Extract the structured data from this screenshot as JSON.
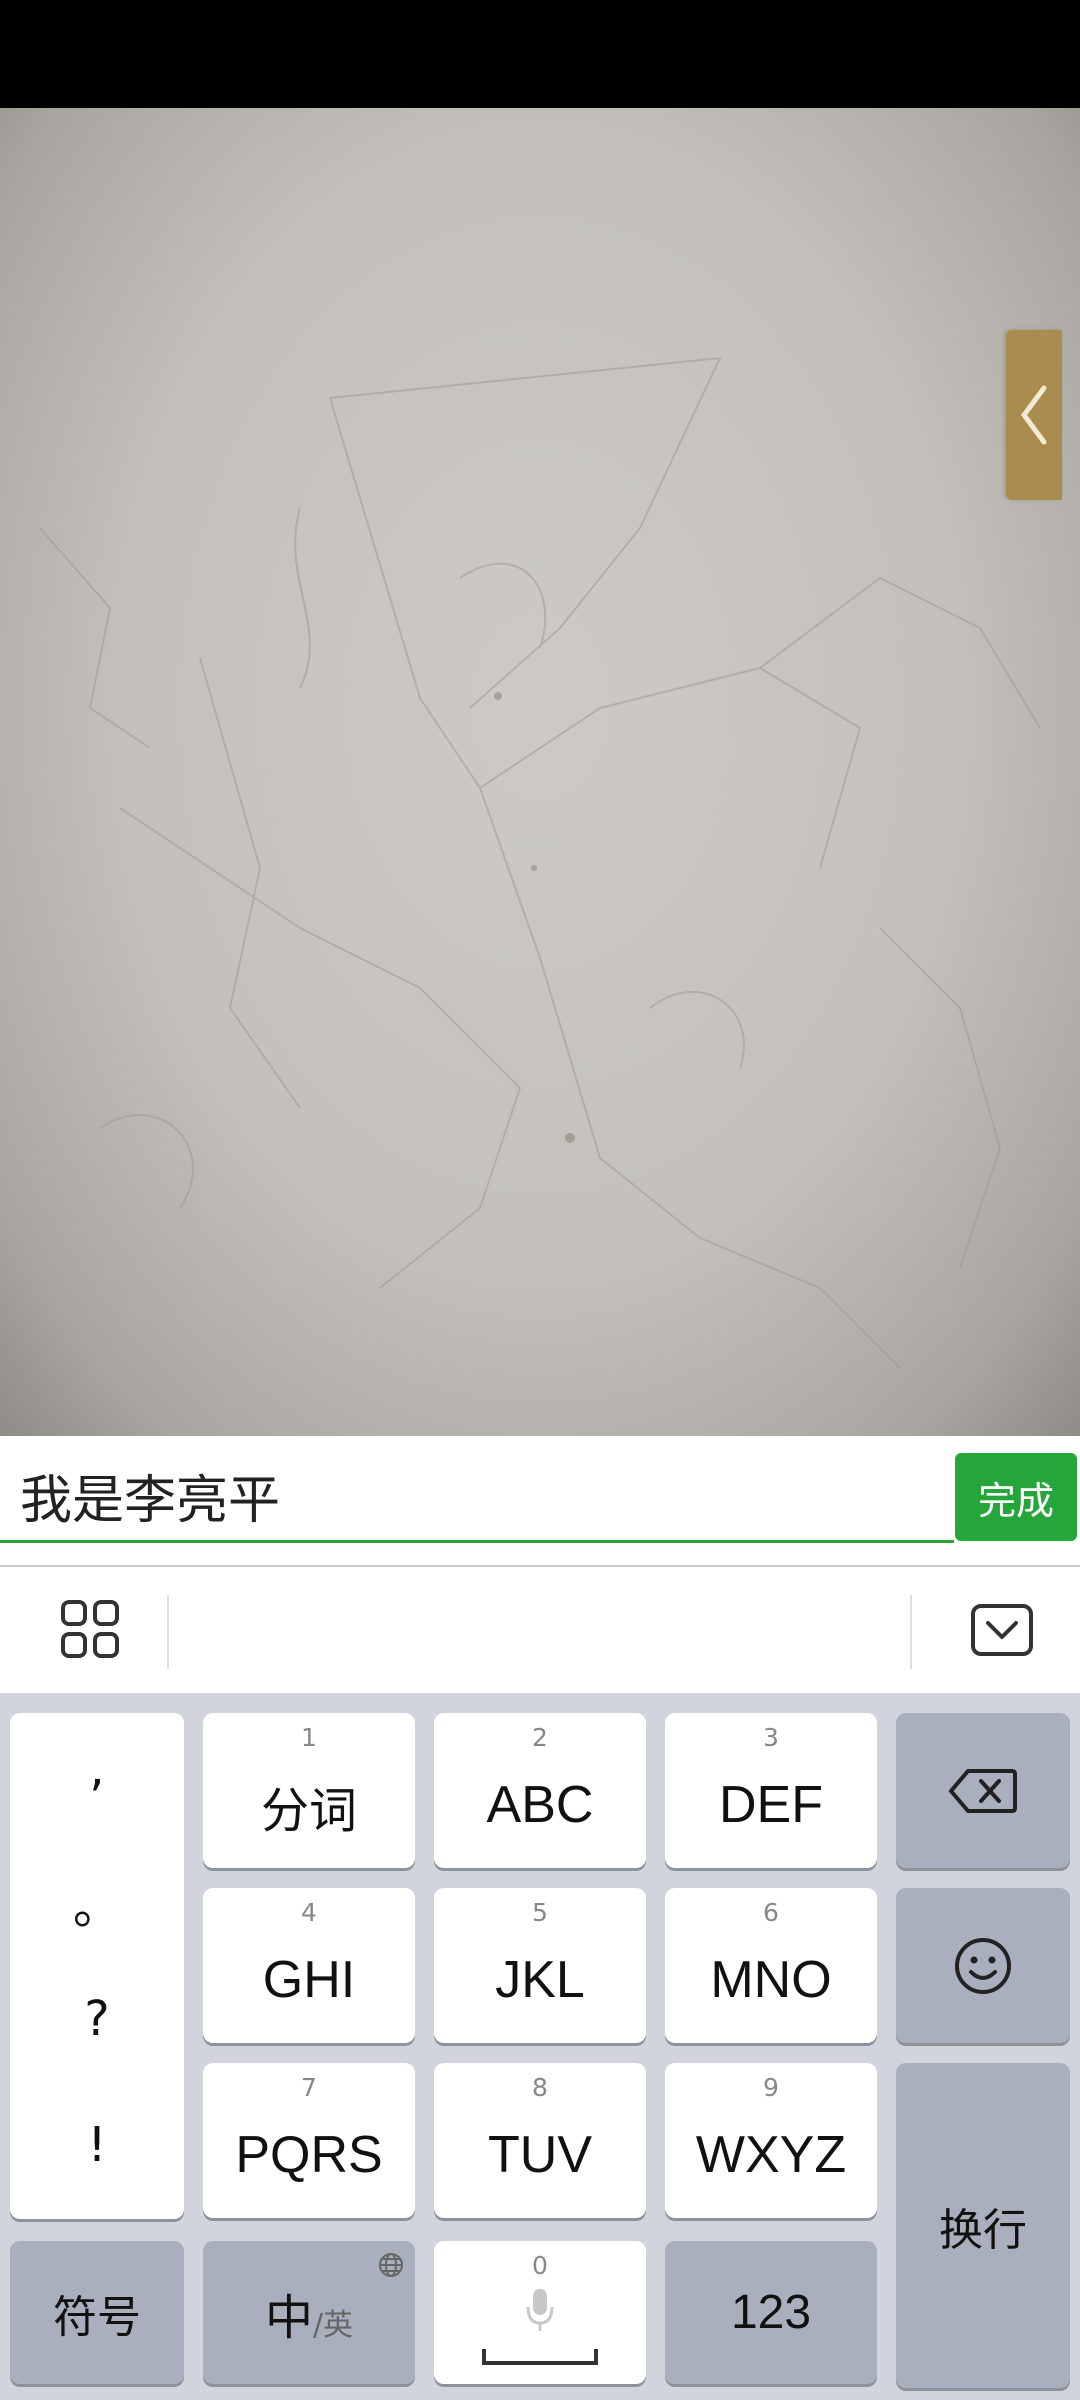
{
  "input": {
    "value": "我是李亮平",
    "done_label": "完成"
  },
  "toolbar": {
    "left_icon": "grid-icon",
    "right_icon": "collapse-keyboard-icon"
  },
  "keyboard": {
    "punctuation": [
      ",",
      "。",
      "?",
      "!"
    ],
    "keys": [
      {
        "num": "1",
        "label": "分词"
      },
      {
        "num": "2",
        "label": "ABC"
      },
      {
        "num": "3",
        "label": "DEF"
      },
      {
        "num": "4",
        "label": "GHI"
      },
      {
        "num": "5",
        "label": "JKL"
      },
      {
        "num": "6",
        "label": "MNO"
      },
      {
        "num": "7",
        "label": "PQRS"
      },
      {
        "num": "8",
        "label": "TUV"
      },
      {
        "num": "9",
        "label": "WXYZ"
      }
    ],
    "backspace_icon": "backspace-icon",
    "emoji_icon": "emoji-icon",
    "enter_label": "换行",
    "symbols_label": "符号",
    "lang_main": "中",
    "lang_sub": "/英",
    "space_num": "0",
    "numbers_label": "123"
  }
}
